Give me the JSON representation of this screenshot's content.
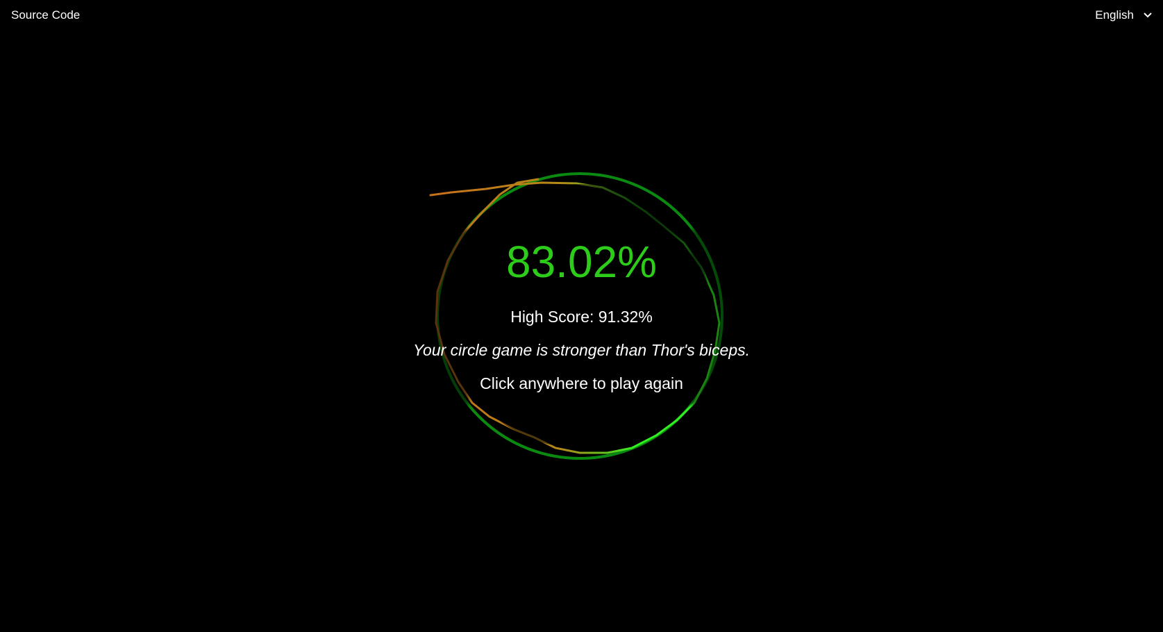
{
  "header": {
    "source_label": "Source Code",
    "language": "English"
  },
  "result": {
    "score": "83.02%",
    "high_score": "High Score: 91.32%",
    "quip": "Your circle game is stronger than Thor's biceps.",
    "play_again": "Click anywhere to play again"
  },
  "colors": {
    "background": "#000000",
    "score": "#2ecc1a",
    "guide_circle": "#0a8a10",
    "good_stroke": "#33ee22",
    "bad_stroke": "#c8701a"
  }
}
